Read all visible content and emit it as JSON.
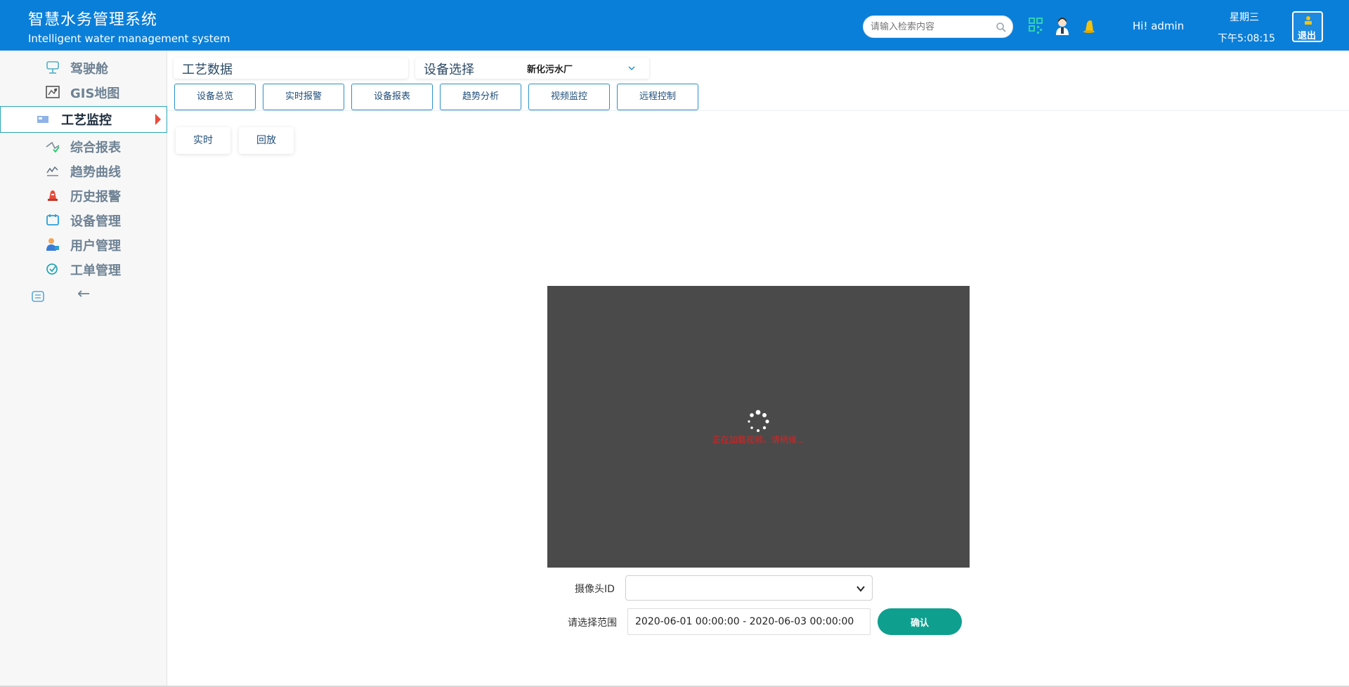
{
  "header": {
    "title_cn": "智慧水务管理系统",
    "title_en": "Intelligent water management system",
    "search_placeholder": "请输入检索内容",
    "greeting": "Hi!  admin",
    "weekday": "星期三",
    "time": "下午5:08:15",
    "logout_label": "退出",
    "icons": [
      "qr-code-icon",
      "user-avatar-icon",
      "bell-icon"
    ]
  },
  "sidebar": {
    "items": [
      {
        "label": "驾驶舱",
        "icon": "cockpit-icon"
      },
      {
        "label": "GIS地图",
        "icon": "map-icon"
      },
      {
        "label": "工艺监控",
        "icon": "monitor-icon",
        "active": true
      },
      {
        "label": "综合报表",
        "icon": "report-icon"
      },
      {
        "label": "趋势曲线",
        "icon": "trend-icon"
      },
      {
        "label": "历史报警",
        "icon": "alarm-icon"
      },
      {
        "label": "设备管理",
        "icon": "device-icon"
      },
      {
        "label": "用户管理",
        "icon": "user-icon"
      },
      {
        "label": "工单管理",
        "icon": "workorder-icon"
      }
    ],
    "collapse_arrow": "←"
  },
  "main": {
    "process_data_label": "工艺数据",
    "device_select_label": "设备选择",
    "device_selected": "新化污水厂",
    "tabs": [
      "设备总览",
      "实时报警",
      "设备报表",
      "趋势分析",
      "视频监控",
      "远程控制"
    ],
    "subtabs": [
      "实时",
      "回放"
    ],
    "video_message": "正在加载视频，请稍候...",
    "camera_id_label": "摄像头ID",
    "range_label": "请选择范围",
    "range_value": "2020-06-01 00:00:00 - 2020-06-03 00:00:00",
    "confirm_label": "确认"
  },
  "colors": {
    "header_bg": "#0a7fd9",
    "active_border": "#2aa7b6",
    "active_arrow": "#e74c3c",
    "confirm_bg": "#0f9f8f",
    "video_bg": "#4a4a4a"
  }
}
